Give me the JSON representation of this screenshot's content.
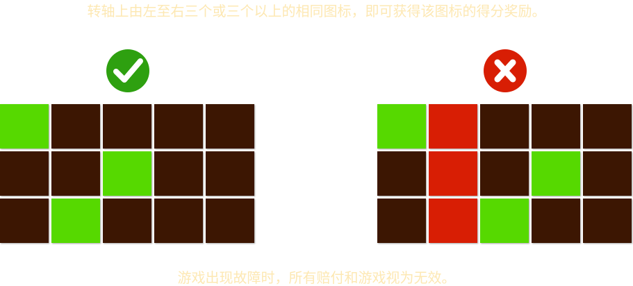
{
  "rules": {
    "top": "转轴上由左至右三个或三个以上的相同图标，即可获得该图标的得分奖励。",
    "bottom": "游戏出现故障时，所有赔付和游戏视为无效。"
  },
  "colors": {
    "rule_text": "#fde8b3",
    "empty": "#3c1602",
    "win": "#56d900",
    "lose": "#d81e04",
    "badge_ok": "#2ea010",
    "badge_bad": "#d81e04"
  },
  "examples": [
    {
      "result": "correct",
      "icon": "checkmark-icon",
      "grid": [
        [
          "win",
          "empty",
          "empty",
          "empty",
          "empty"
        ],
        [
          "empty",
          "empty",
          "win",
          "empty",
          "empty"
        ],
        [
          "empty",
          "win",
          "empty",
          "empty",
          "empty"
        ]
      ]
    },
    {
      "result": "incorrect",
      "icon": "cross-icon",
      "grid": [
        [
          "win",
          "lose",
          "empty",
          "empty",
          "empty"
        ],
        [
          "empty",
          "lose",
          "empty",
          "win",
          "empty"
        ],
        [
          "empty",
          "lose",
          "win",
          "empty",
          "empty"
        ]
      ]
    }
  ]
}
